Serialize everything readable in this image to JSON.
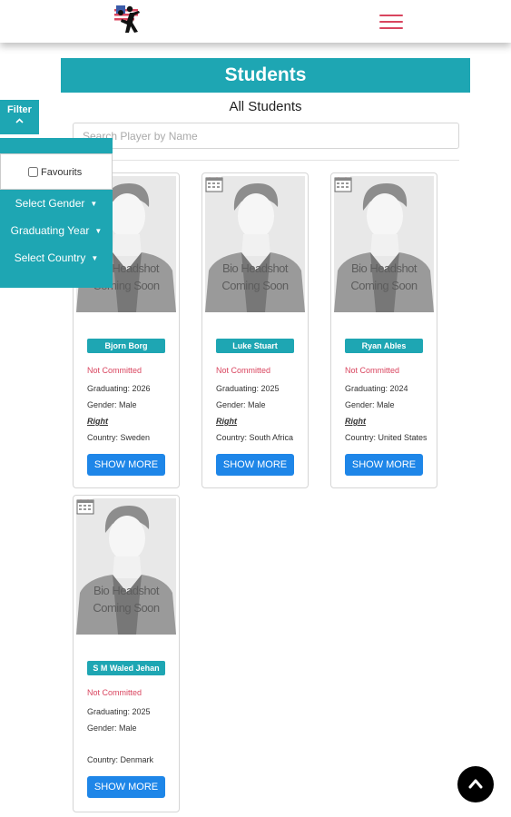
{
  "header": {
    "logo_icon": "player-silhouette-logo",
    "menu_icon": "hamburger-icon",
    "accent_color": "#d9455f"
  },
  "page": {
    "title": "Students",
    "subtitle": "All Students",
    "search_placeholder": "Search Player by Name",
    "brand_color": "#1ea6b3",
    "button_color": "#1e86e8"
  },
  "filter": {
    "tab_label": "Filter",
    "favourites_label": "Favourits",
    "favourites_checked": false,
    "gender_label": "Select Gender",
    "year_label": "Graduating Year",
    "country_label": "Select Country"
  },
  "placeholder_caption": [
    "Bio Headshot",
    "Coming Soon"
  ],
  "students": [
    {
      "name": "Bjorn Borg",
      "status": "Not Committed",
      "graduating": "Graduating: 2026",
      "gender": "Gender: Male",
      "hand": "Right",
      "country": "Country: Sweden",
      "button": "SHOW MORE",
      "favourite": false
    },
    {
      "name": "Luke Stuart",
      "status": "Not Committed",
      "graduating": "Graduating: 2025",
      "gender": "Gender: Male",
      "hand": "Right",
      "country": "Country: South Africa",
      "button": "SHOW MORE",
      "favourite": true
    },
    {
      "name": "Ryan Ables",
      "status": "Not Committed",
      "graduating": "Graduating: 2024",
      "gender": "Gender: Male",
      "hand": "Right",
      "country": "Country: United States",
      "button": "SHOW MORE",
      "favourite": true
    },
    {
      "name": "S M Waled Jehan",
      "status": "Not Committed",
      "graduating": "Graduating: 2025",
      "gender": "Gender: Male",
      "hand": "",
      "country": "Country: Denmark",
      "button": "SHOW MORE",
      "favourite": true
    }
  ],
  "scroll_top_icon": "chevron-up-icon"
}
